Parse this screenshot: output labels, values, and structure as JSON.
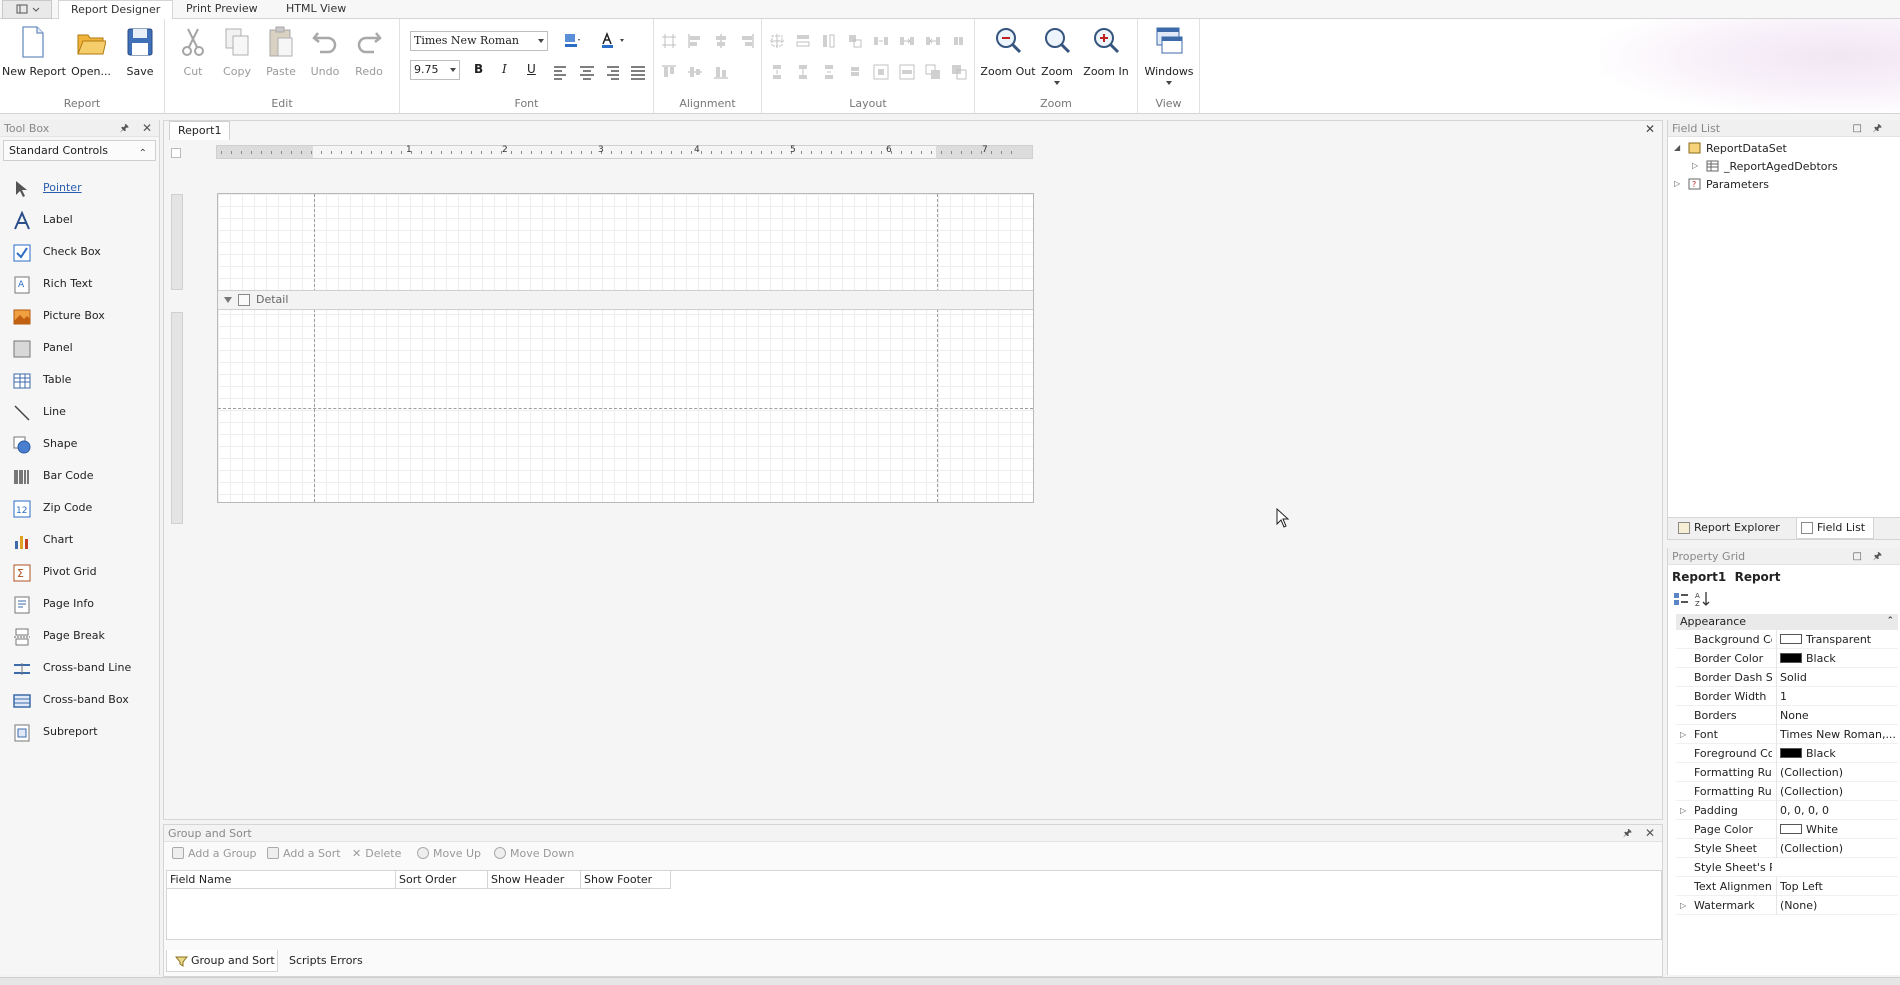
{
  "tabs": [
    "Report Designer",
    "Print Preview",
    "HTML View"
  ],
  "ribbon": {
    "groups": {
      "report": "Report",
      "edit": "Edit",
      "font": "Font",
      "alignment": "Alignment",
      "layout": "Layout",
      "zoom": "Zoom",
      "view": "View"
    },
    "buttons": {
      "new_report": "New Report",
      "open": "Open...",
      "save": "Save",
      "cut": "Cut",
      "copy": "Copy",
      "paste": "Paste",
      "undo": "Undo",
      "redo": "Redo",
      "zoom_out": "Zoom Out",
      "zoom": "Zoom",
      "zoom_in": "Zoom In",
      "windows": "Windows"
    },
    "font_name": "Times New Roman",
    "font_size": "9.75",
    "format": {
      "bold": "B",
      "italic": "I",
      "underline": "U"
    },
    "accent_color": "#2b6cc4"
  },
  "toolbox": {
    "title": "Tool Box",
    "category": "Standard Controls",
    "items": [
      "Pointer",
      "Label",
      "Check Box",
      "Rich Text",
      "Picture Box",
      "Panel",
      "Table",
      "Line",
      "Shape",
      "Bar Code",
      "Zip Code",
      "Chart",
      "Pivot Grid",
      "Page Info",
      "Page Break",
      "Cross-band Line",
      "Cross-band Box",
      "Subreport"
    ],
    "icons": [
      "pointer-icon",
      "label-icon",
      "checkbox-icon",
      "rich-text-icon",
      "picture-box-icon",
      "panel-icon",
      "table-icon",
      "line-icon",
      "shape-icon",
      "barcode-icon",
      "zipcode-icon",
      "chart-icon",
      "pivot-grid-icon",
      "page-info-icon",
      "page-break-icon",
      "cross-band-line-icon",
      "cross-band-box-icon",
      "subreport-icon"
    ]
  },
  "document": {
    "tab": "Report1",
    "band": "Detail",
    "ruler_numbers": [
      "1",
      "2",
      "3",
      "4",
      "5",
      "6",
      "7"
    ]
  },
  "group_sort": {
    "title": "Group and Sort",
    "buttons": [
      "Add a Group",
      "Add a Sort",
      "Delete",
      "Move Up",
      "Move Down"
    ],
    "columns": [
      "Field Name",
      "Sort Order",
      "Show Header",
      "Show Footer"
    ],
    "bottom_tabs": [
      "Group and Sort",
      "Scripts Errors"
    ]
  },
  "field_list": {
    "title": "Field List",
    "root": "ReportDataSet",
    "child": "_ReportAgedDebtors",
    "params": "Parameters",
    "tabs": [
      "Report Explorer",
      "Field List"
    ]
  },
  "property_grid": {
    "title": "Property Grid",
    "object_name": "Report1",
    "object_type": "Report",
    "category": "Appearance",
    "rows": [
      {
        "name": "Background Color",
        "value": "Transparent",
        "swatch": "#ffffff",
        "expandable": false
      },
      {
        "name": "Border Color",
        "value": "Black",
        "swatch": "#000000",
        "expandable": false
      },
      {
        "name": "Border Dash Style",
        "value": "Solid",
        "swatch": "",
        "expandable": false
      },
      {
        "name": "Border Width",
        "value": "1",
        "swatch": "",
        "expandable": false
      },
      {
        "name": "Borders",
        "value": "None",
        "swatch": "",
        "expandable": false
      },
      {
        "name": "Font",
        "value": "Times New Roman,...",
        "swatch": "",
        "expandable": true
      },
      {
        "name": "Foreground Color",
        "value": "Black",
        "swatch": "#000000",
        "expandable": false
      },
      {
        "name": "Formatting Rules",
        "value": "(Collection)",
        "swatch": "",
        "expandable": false
      },
      {
        "name": "Formatting Rule Sheet",
        "value": "(Collection)",
        "swatch": "",
        "expandable": false
      },
      {
        "name": "Padding",
        "value": "0, 0, 0, 0",
        "swatch": "",
        "expandable": true
      },
      {
        "name": "Page Color",
        "value": "White",
        "swatch": "#ffffff",
        "expandable": false
      },
      {
        "name": "Style Sheet",
        "value": "(Collection)",
        "swatch": "",
        "expandable": false
      },
      {
        "name": "Style Sheet's Path",
        "value": "",
        "swatch": "",
        "expandable": false
      },
      {
        "name": "Text Alignment",
        "value": "Top Left",
        "swatch": "",
        "expandable": false
      },
      {
        "name": "Watermark",
        "value": "(None)",
        "swatch": "",
        "expandable": true
      }
    ]
  }
}
